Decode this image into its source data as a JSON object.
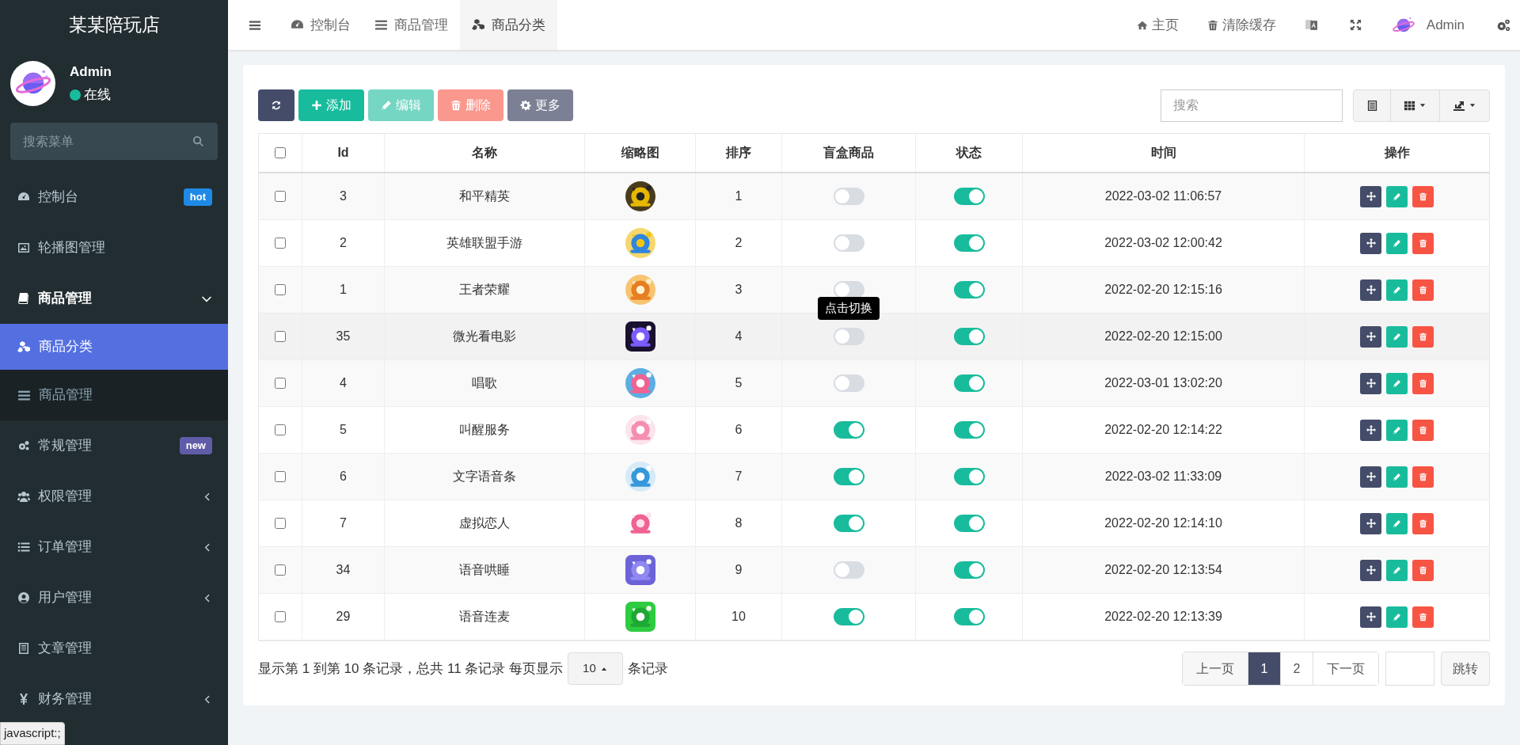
{
  "sidebar": {
    "brand": "某某陪玩店",
    "user": {
      "name": "Admin",
      "status": "在线"
    },
    "search": {
      "placeholder": "搜索菜单"
    },
    "items": [
      {
        "label": "控制台",
        "selected": false,
        "badge": {
          "text": "hot",
          "color": "#1e8ae6"
        }
      },
      {
        "label": "轮播图管理",
        "selected": false
      },
      {
        "label": "商品管理",
        "selected": false,
        "expanded": true,
        "children": [
          {
            "label": "商品分类",
            "selected": true
          },
          {
            "label": "商品管理",
            "selected": false
          }
        ]
      },
      {
        "label": "常规管理",
        "selected": false,
        "badge": {
          "text": "new",
          "color": "#605ca8"
        }
      },
      {
        "label": "权限管理",
        "selected": false,
        "expanded": false
      },
      {
        "label": "订单管理",
        "selected": false,
        "expanded": false
      },
      {
        "label": "用户管理",
        "selected": false,
        "expanded": false
      },
      {
        "label": "文章管理",
        "selected": false
      },
      {
        "label": "财务管理",
        "selected": false,
        "expanded": false
      }
    ]
  },
  "header": {
    "tabs": [
      {
        "label": "控制台",
        "selected": false
      },
      {
        "label": "商品管理",
        "selected": false
      },
      {
        "label": "商品分类",
        "selected": true
      }
    ],
    "links": [
      "主页",
      "清除缓存"
    ],
    "user": "Admin"
  },
  "toolbar": {
    "buttons": [
      {
        "kind": "refresh",
        "disabled": false
      },
      {
        "kind": "add",
        "label": "添加",
        "disabled": false
      },
      {
        "kind": "edit",
        "label": "编辑",
        "disabled": true
      },
      {
        "kind": "delete",
        "label": "删除",
        "disabled": true
      },
      {
        "kind": "more",
        "label": "更多",
        "disabled": false
      }
    ],
    "search": {
      "placeholder": "搜索"
    }
  },
  "table": {
    "select_all": {
      "checked": false
    },
    "columns": [
      "Id",
      "名称",
      "缩略图",
      "排序",
      "盲盒商品",
      "状态",
      "时间",
      "操作"
    ],
    "rows": [
      {
        "id": "3",
        "name": "和平精英",
        "sort": "1",
        "blind_box": false,
        "status": true,
        "time": "2022-03-02 11:06:57",
        "hovered": false
      },
      {
        "id": "2",
        "name": "英雄联盟手游",
        "sort": "2",
        "blind_box": false,
        "status": true,
        "time": "2022-03-02 12:00:42",
        "hovered": false
      },
      {
        "id": "1",
        "name": "王者荣耀",
        "sort": "3",
        "blind_box": false,
        "status": true,
        "time": "2022-02-20 12:15:16",
        "hovered": false
      },
      {
        "id": "35",
        "name": "微光看电影",
        "sort": "4",
        "blind_box": false,
        "status": true,
        "time": "2022-02-20 12:15:00",
        "hovered": true,
        "tooltip": "点击切换"
      },
      {
        "id": "4",
        "name": "唱歌",
        "sort": "5",
        "blind_box": false,
        "status": true,
        "time": "2022-03-01 13:02:20",
        "hovered": false
      },
      {
        "id": "5",
        "name": "叫醒服务",
        "sort": "6",
        "blind_box": true,
        "status": true,
        "time": "2022-02-20 12:14:22",
        "hovered": false
      },
      {
        "id": "6",
        "name": "文字语音条",
        "sort": "7",
        "blind_box": true,
        "status": true,
        "time": "2022-03-02 11:33:09",
        "hovered": false
      },
      {
        "id": "7",
        "name": "虚拟恋人",
        "sort": "8",
        "blind_box": true,
        "status": true,
        "time": "2022-02-20 12:14:10",
        "hovered": false
      },
      {
        "id": "34",
        "name": "语音哄睡",
        "sort": "9",
        "blind_box": false,
        "status": true,
        "time": "2022-02-20 12:13:54",
        "hovered": false
      },
      {
        "id": "29",
        "name": "语音连麦",
        "sort": "10",
        "blind_box": true,
        "status": true,
        "time": "2022-02-20 12:13:39",
        "hovered": false
      }
    ]
  },
  "footer": {
    "summary": "显示第 1 到第 10 条记录，总共 11 条记录 每页显示",
    "page_size": "10",
    "suffix": "条记录",
    "prev": "上一页",
    "pages": [
      {
        "label": "1",
        "selected": true
      },
      {
        "label": "2",
        "selected": false
      }
    ],
    "next": "下一页",
    "jump": "跳转"
  },
  "status_bar": "javascript:;"
}
